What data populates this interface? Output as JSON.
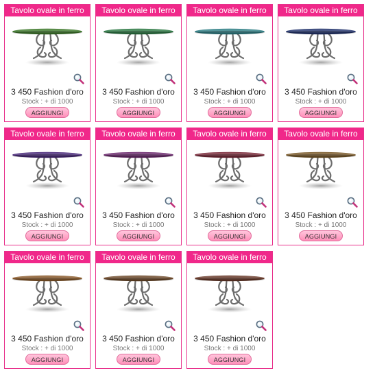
{
  "products": [
    {
      "title": "Tavolo ovale in ferro",
      "price": "3 450 Fashion d'oro",
      "stock": "Stock : + di 1000",
      "button": "AGGIUNGI",
      "color": "#3f7a2c"
    },
    {
      "title": "Tavolo ovale in ferro",
      "price": "3 450 Fashion d'oro",
      "stock": "Stock : + di 1000",
      "button": "AGGIUNGI",
      "color": "#2e7a45"
    },
    {
      "title": "Tavolo ovale in ferro",
      "price": "3 450 Fashion d'oro",
      "stock": "Stock : + di 1000",
      "button": "AGGIUNGI",
      "color": "#2f7f86"
    },
    {
      "title": "Tavolo ovale in ferro",
      "price": "3 450 Fashion d'oro",
      "stock": "Stock : + di 1000",
      "button": "AGGIUNGI",
      "color": "#24356e"
    },
    {
      "title": "Tavolo ovale in ferro",
      "price": "3 450 Fashion d'oro",
      "stock": "Stock : + di 1000",
      "button": "AGGIUNGI",
      "color": "#4a2a7a"
    },
    {
      "title": "Tavolo ovale in ferro",
      "price": "3 450 Fashion d'oro",
      "stock": "Stock : + di 1000",
      "button": "AGGIUNGI",
      "color": "#6c2a6e"
    },
    {
      "title": "Tavolo ovale in ferro",
      "price": "3 450 Fashion d'oro",
      "stock": "Stock : + di 1000",
      "button": "AGGIUNGI",
      "color": "#7a2a3a"
    },
    {
      "title": "Tavolo ovale in ferro",
      "price": "3 450 Fashion d'oro",
      "stock": "Stock : + di 1000",
      "button": "AGGIUNGI",
      "color": "#7a5a2a"
    },
    {
      "title": "Tavolo ovale in ferro",
      "price": "3 450 Fashion d'oro",
      "stock": "Stock : + di 1000",
      "button": "AGGIUNGI",
      "color": "#8a5a2a"
    },
    {
      "title": "Tavolo ovale in ferro",
      "price": "3 450 Fashion d'oro",
      "stock": "Stock : + di 1000",
      "button": "AGGIUNGI",
      "color": "#6e4a2a"
    },
    {
      "title": "Tavolo ovale in ferro",
      "price": "3 450 Fashion d'oro",
      "stock": "Stock : + di 1000",
      "button": "AGGIUNGI",
      "color": "#6a3a2a"
    }
  ],
  "icons": {
    "zoom": "magnifier-icon",
    "table": "oval-iron-table-icon"
  },
  "colors": {
    "accent": "#f0288a",
    "button": "#ff9cc2"
  }
}
